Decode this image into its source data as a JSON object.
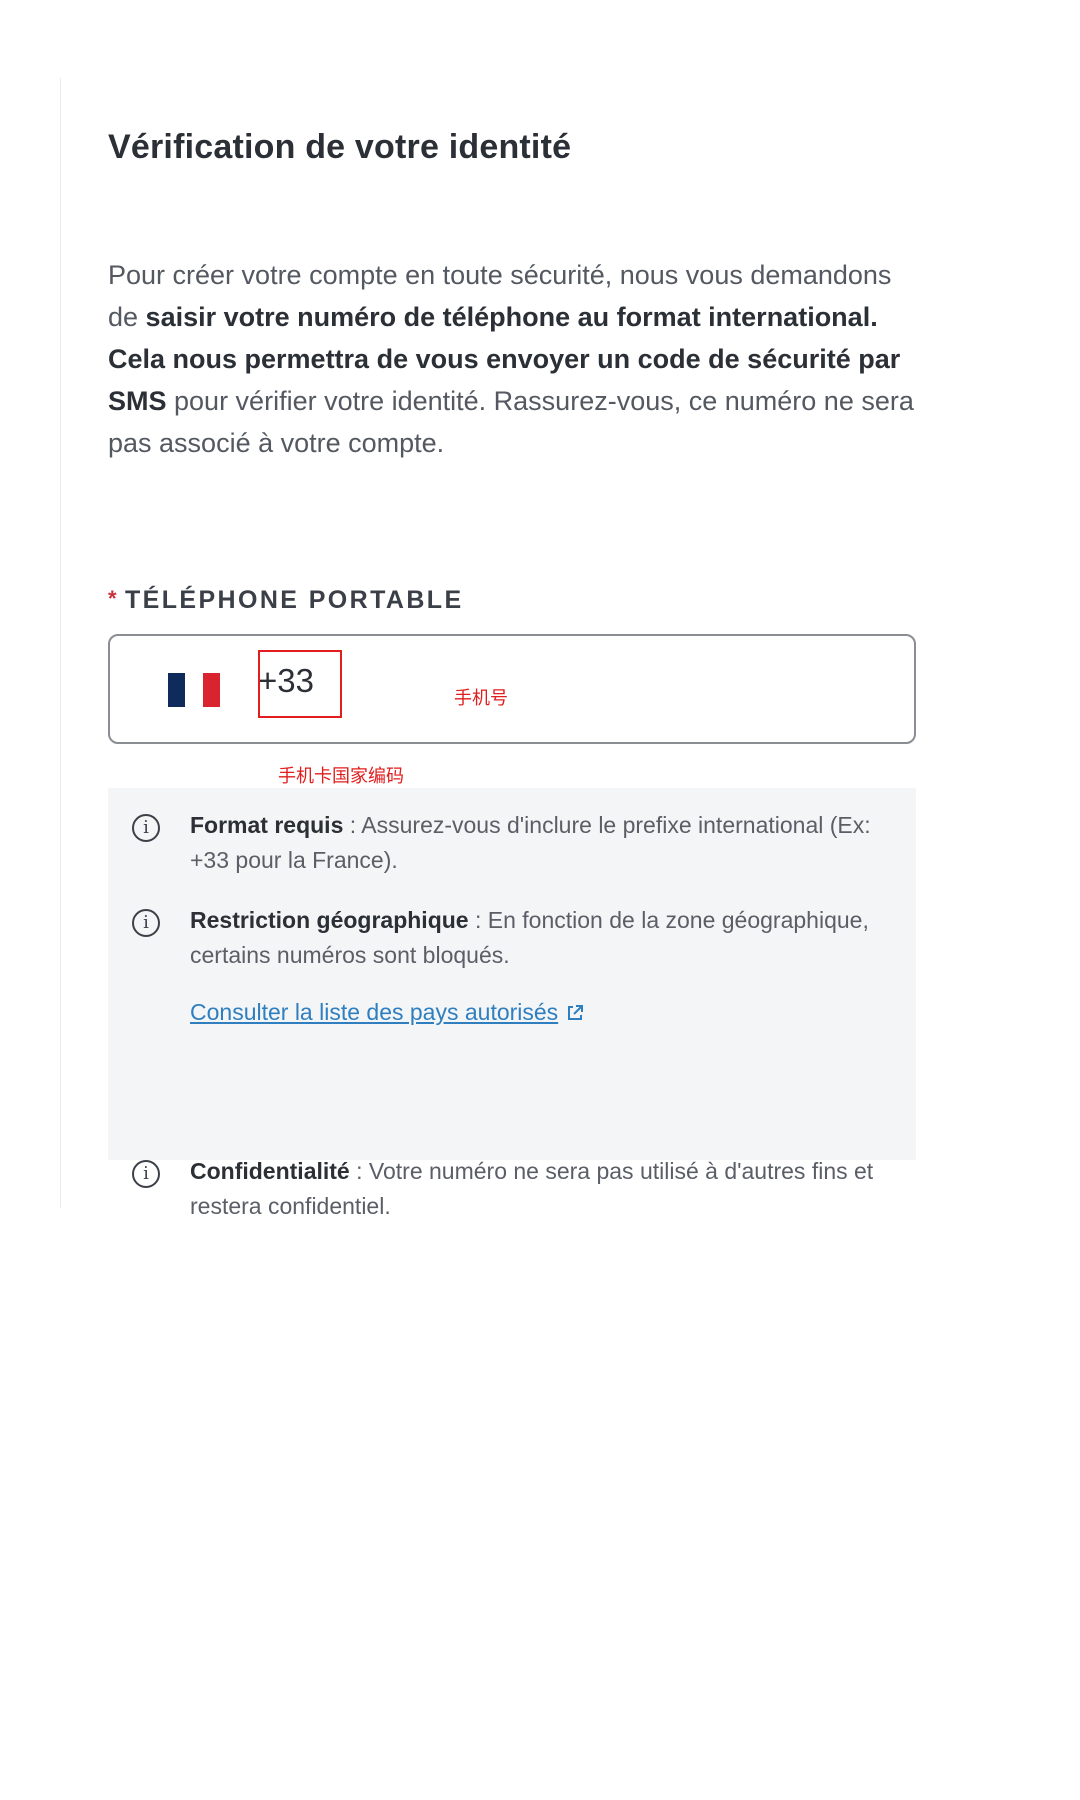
{
  "page": {
    "title": "Vérification de votre identité"
  },
  "intro": {
    "text_1": "Pour créer votre compte en toute sécurité, nous vous demandons de ",
    "bold_1": "saisir votre numéro de téléphone au format international. Cela nous permettra de vous envoyer un code de sécurité par SMS",
    "text_2": " pour vérifier votre identité. Rassurez-vous, ce numéro ne sera pas associé à votre compte."
  },
  "phone_field": {
    "required_marker": "*",
    "label": "TÉLÉPHONE PORTABLE",
    "country_flag": "flag-france-icon",
    "dial_code": "+33",
    "number_annotation": "手机号",
    "country_code_annotation": "手机卡国家编码",
    "annotation_color": "#e11d1d"
  },
  "notice": {
    "items": [
      {
        "icon": "info-icon",
        "title": "Format requis",
        "text": " : Assurez-vous d'inclure le prefixe international (Ex: +33 pour la France)."
      },
      {
        "icon": "info-icon",
        "title": "Restriction géographique",
        "text": " : En fonction de la zone géographique, certains numéros sont bloqués."
      },
      {
        "icon": "info-icon",
        "title": "Confidentialité",
        "text": " : Votre numéro ne sera pas utilisé à d'autres fins et restera confidentiel."
      }
    ],
    "link_label": "Consulter la liste des pays autorisés",
    "link_icon": "external-link-icon",
    "link_color": "#2f7fc0"
  }
}
